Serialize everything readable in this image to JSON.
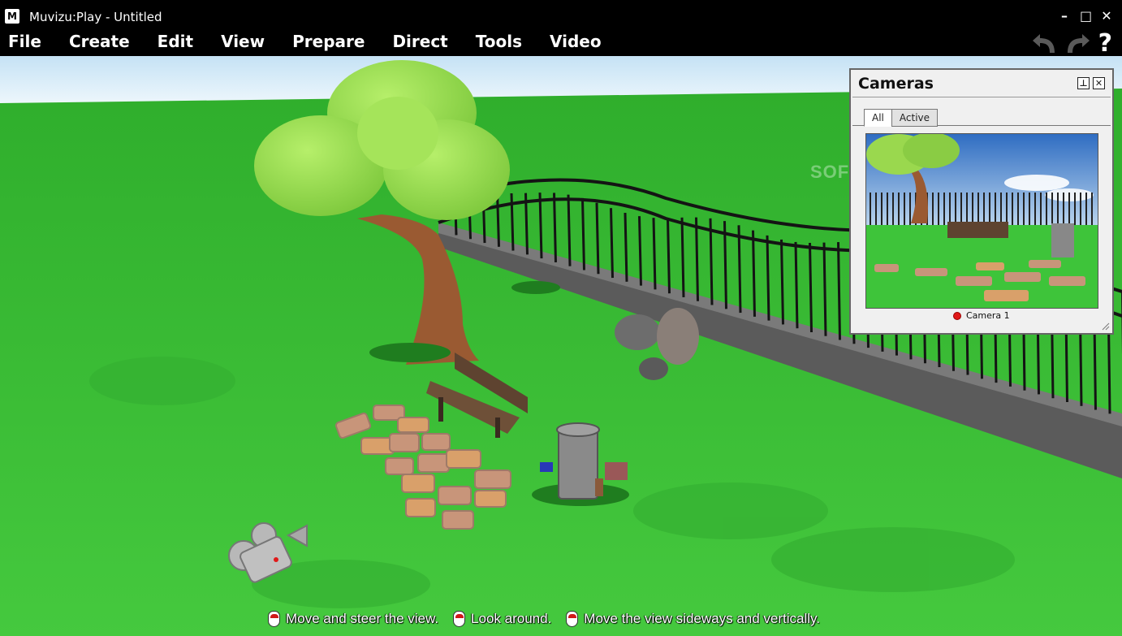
{
  "window": {
    "logo": "M",
    "title": "Muvizu:Play - Untitled",
    "controls": [
      "minimize-icon",
      "maximize-icon",
      "close-icon"
    ]
  },
  "menu": {
    "items": [
      "File",
      "Create",
      "Edit",
      "View",
      "Prepare",
      "Direct",
      "Tools",
      "Video"
    ],
    "help": "?"
  },
  "cameras_panel": {
    "title": "Cameras",
    "pin": "⊥",
    "close": "✕",
    "tabs": [
      "All",
      "Active"
    ],
    "selected_tab": "All",
    "camera_name": "Camera 1",
    "camera_status_color": "#e01818"
  },
  "watermark": "SOFTPEDIA",
  "hints": [
    "Move and steer the view.",
    "Look around.",
    "Move the view sideways and vertically."
  ],
  "colors": {
    "grass": "#3ec43a",
    "sky": "#d8ecf8",
    "foliage": "#8fd846",
    "trunk": "#9a5a32",
    "fence": "#1a1a1a",
    "wall": "#555555"
  }
}
